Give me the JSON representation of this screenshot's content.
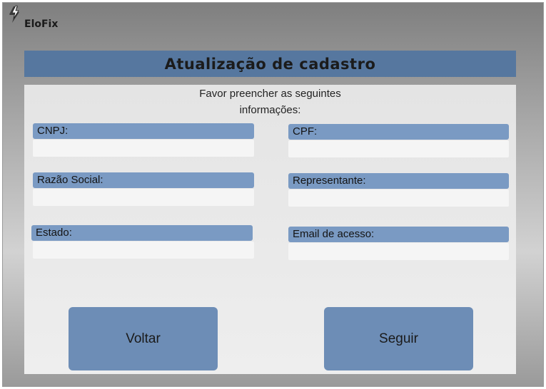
{
  "app": {
    "logo_text": "EloFix"
  },
  "header": {
    "title": "Atualização de cadastro"
  },
  "form": {
    "intro_line1": "Favor preencher as seguintes",
    "intro_line2": "informações:",
    "fields": {
      "cnpj": {
        "label": "CNPJ:",
        "value": ""
      },
      "cpf": {
        "label": "CPF:",
        "value": ""
      },
      "razao_social": {
        "label": "Razão Social:",
        "value": ""
      },
      "representante": {
        "label": "Representante:",
        "value": ""
      },
      "estado": {
        "label": "Estado:",
        "value": ""
      },
      "email": {
        "label": "Email de acesso:",
        "value": ""
      }
    }
  },
  "buttons": {
    "back": "Voltar",
    "next": "Seguir"
  },
  "icons": {
    "logo": "lightning-bolt-icon"
  },
  "colors": {
    "accent": "#56779f",
    "label_bg": "#7a9ac3",
    "button_bg": "#6d8db6"
  }
}
